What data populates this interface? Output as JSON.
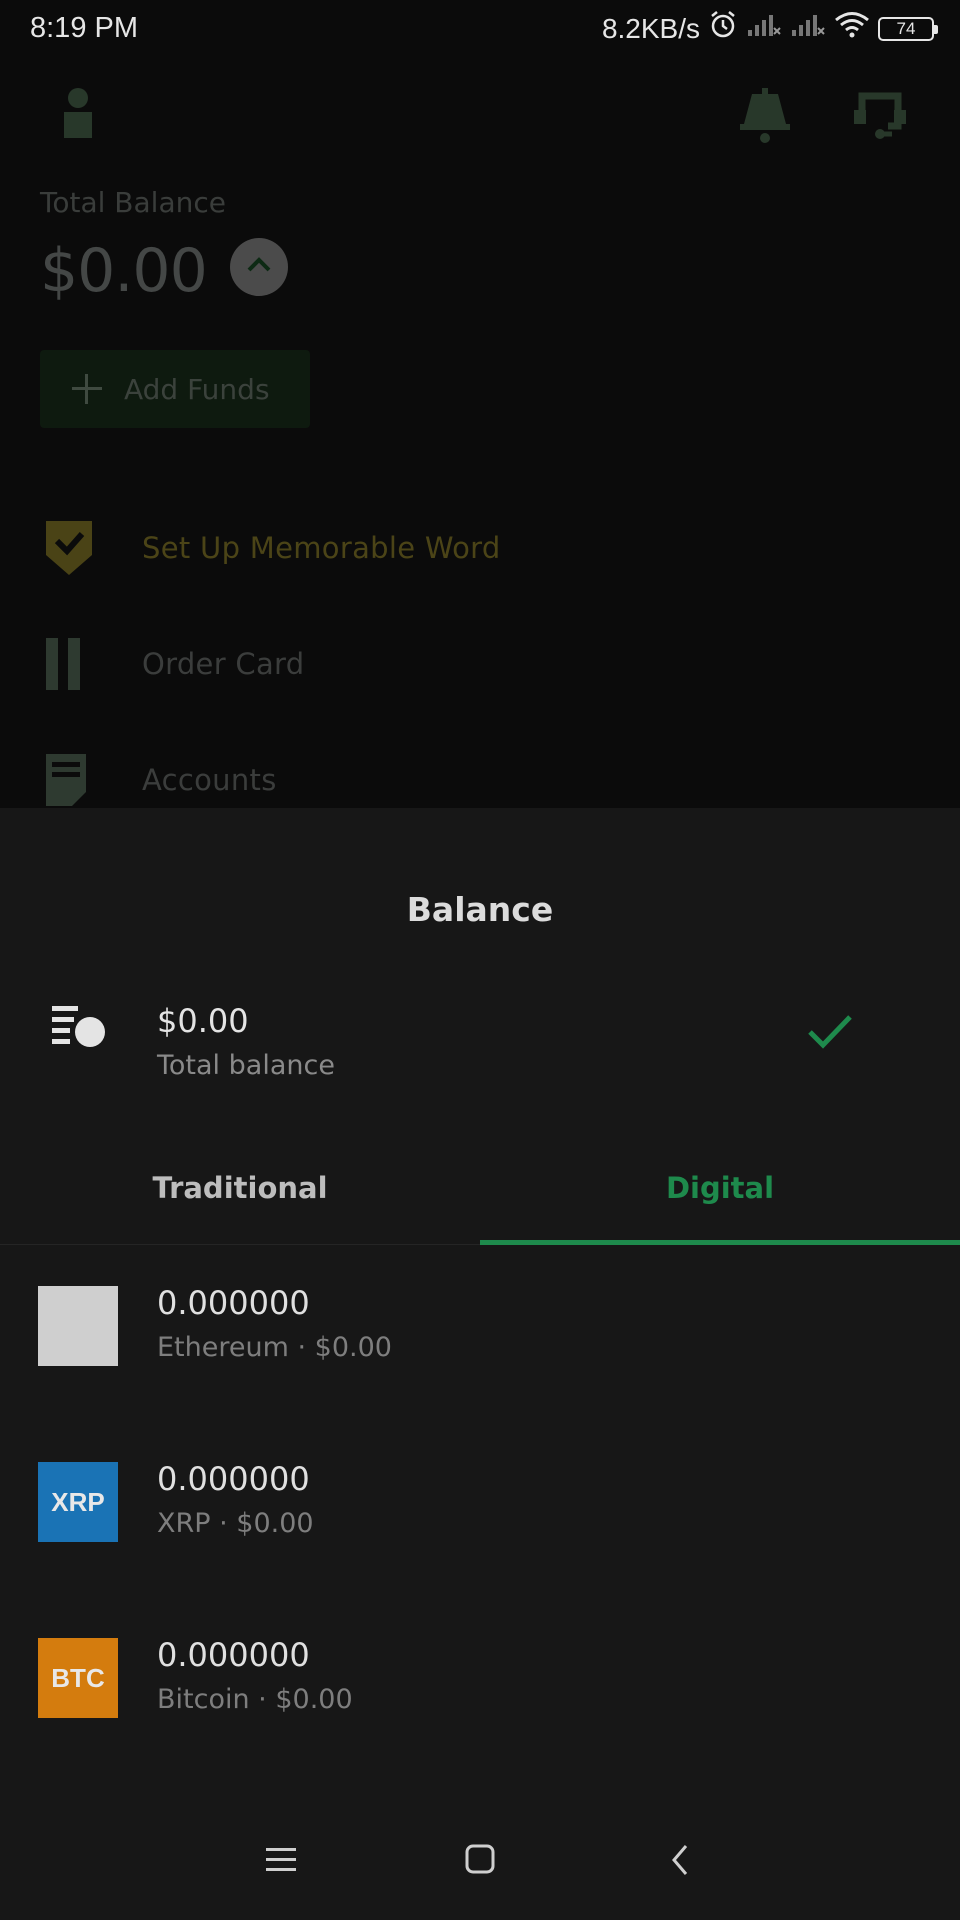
{
  "status_bar": {
    "time": "8:19 PM",
    "network_speed": "8.2KB/s",
    "battery": "74"
  },
  "background": {
    "total_balance_label": "Total Balance",
    "total_balance_amount": "$0.00",
    "add_funds_label": "Add Funds",
    "menu_items": [
      {
        "label": "Set Up Memorable Word",
        "icon": "shield-check-icon"
      },
      {
        "label": "Order Card",
        "icon": "card-icon"
      },
      {
        "label": "Accounts",
        "icon": "document-icon"
      }
    ]
  },
  "sheet": {
    "title": "Balance",
    "total": {
      "amount": "$0.00",
      "label": "Total balance"
    },
    "tabs": [
      {
        "label": "Traditional",
        "selected": false
      },
      {
        "label": "Digital",
        "selected": true
      }
    ],
    "assets": [
      {
        "logo_text": "",
        "amount": "0.000000",
        "name": "Ethereum",
        "value": "$0.00",
        "sub": "Ethereum · $0.00",
        "color": "#cfcfcf"
      },
      {
        "logo_text": "XRP",
        "amount": "0.000000",
        "name": "XRP",
        "value": "$0.00",
        "sub": "XRP · $0.00",
        "color": "#1a73b5"
      },
      {
        "logo_text": "BTC",
        "amount": "0.000000",
        "name": "Bitcoin",
        "value": "$0.00",
        "sub": "Bitcoin · $0.00",
        "color": "#d47c0e"
      }
    ]
  },
  "colors": {
    "accent": "#1e8a4c",
    "sheet_background": "#171717"
  }
}
